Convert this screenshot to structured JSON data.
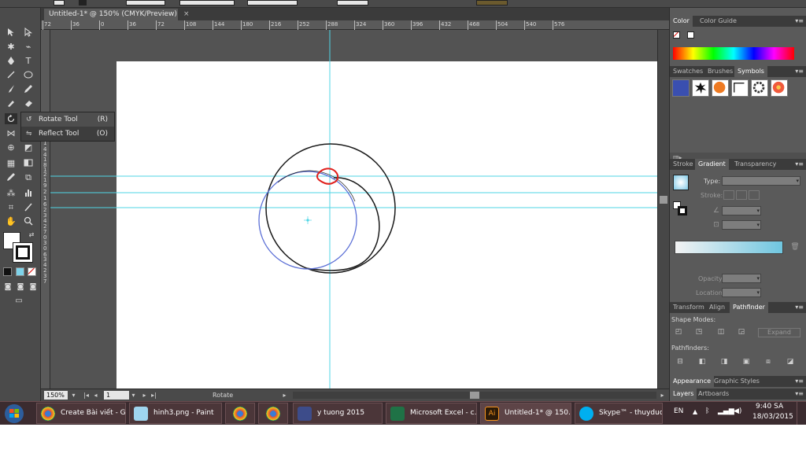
{
  "document_tab": {
    "title": "Untitled-1* @ 150% (CMYK/Preview)",
    "close": "×"
  },
  "ruler_h_ticks": [
    "72",
    "36",
    "0",
    "36",
    "72",
    "108",
    "144",
    "180",
    "216",
    "252",
    "288",
    "324",
    "360",
    "396",
    "432",
    "468",
    "504",
    "540",
    "576"
  ],
  "ruler_v_ticks": [
    "1",
    "4",
    "4",
    "1",
    "8",
    "1",
    "2",
    "1",
    "9",
    "2",
    "1",
    "6",
    "2",
    "3",
    "4",
    "2",
    "7",
    "0",
    "3",
    "0",
    "6",
    "3",
    "4",
    "2",
    "3",
    "7"
  ],
  "flyout": {
    "items": [
      {
        "label": "Rotate Tool",
        "shortcut": "(R)"
      },
      {
        "label": "Reflect Tool",
        "shortcut": "(O)"
      }
    ]
  },
  "status": {
    "zoom": "150%",
    "artboard": "1",
    "tool": "Rotate"
  },
  "color_panel": {
    "tabs": [
      "Color",
      "Color Guide"
    ]
  },
  "swatch_panel": {
    "tabs": [
      "Swatches",
      "Brushes",
      "Symbols"
    ]
  },
  "gradient_panel": {
    "tabs": [
      "Stroke",
      "Gradient",
      "Transparency"
    ],
    "type_label": "Type:",
    "stroke_label": "Stroke:",
    "opacity_label": "Opacity:",
    "location_label": "Location:"
  },
  "pathfinder_panel": {
    "tabs": [
      "Transform",
      "Align",
      "Pathfinder"
    ],
    "shape_modes_label": "Shape Modes:",
    "expand_label": "Expand",
    "pathfinders_label": "Pathfinders:"
  },
  "appearance_panel": {
    "tabs": [
      "Appearance",
      "Graphic Styles"
    ]
  },
  "layers_panel": {
    "tabs": [
      "Layers",
      "Artboards"
    ]
  },
  "taskbar": {
    "tasks": [
      {
        "label": "Create Bài viết - G...",
        "icon": "chrome-icon"
      },
      {
        "label": "hinh3.png - Paint",
        "icon": "paint-icon"
      },
      {
        "label": "",
        "icon": "chrome-icon"
      },
      {
        "label": "",
        "icon": "chrome-icon"
      },
      {
        "label": "y tuong 2015",
        "icon": "folder-icon"
      },
      {
        "label": "Microsoft Excel - c...",
        "icon": "excel-icon"
      },
      {
        "label": "Untitled-1* @ 150...",
        "icon": "illustrator-icon"
      },
      {
        "label": "Skype™ - thuyduo...",
        "icon": "skype-icon"
      }
    ],
    "language": "EN",
    "time": "9:40 SA",
    "date": "18/03/2015"
  },
  "colors": {
    "guide": "#4fd6e6",
    "selection": "#5b6fd6",
    "red_shape": "#e0201c",
    "app_bg": "#535353",
    "panel_bg": "#5a5a5a"
  }
}
